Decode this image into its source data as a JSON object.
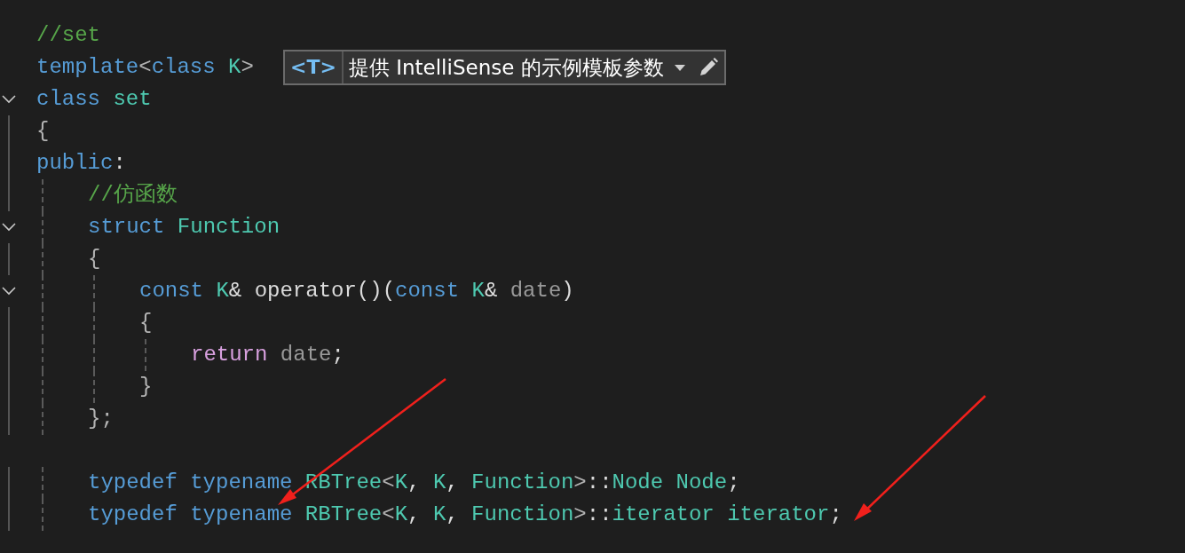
{
  "editor": {
    "lines": [
      {
        "tokens": [
          {
            "kind": "comment",
            "text": "//set"
          }
        ]
      },
      {
        "tokens": [
          {
            "kind": "keyword",
            "text": "template"
          },
          {
            "kind": "punct",
            "text": "<"
          },
          {
            "kind": "keyword",
            "text": "class "
          },
          {
            "kind": "type",
            "text": "K"
          },
          {
            "kind": "punct",
            "text": ">"
          }
        ]
      },
      {
        "expanded": true,
        "tokens": [
          {
            "kind": "keyword",
            "text": "class "
          },
          {
            "kind": "type",
            "text": "set"
          }
        ]
      },
      {
        "tokens": [
          {
            "kind": "punct",
            "text": "{"
          }
        ]
      },
      {
        "tokens": [
          {
            "kind": "keyword",
            "text": "public"
          },
          {
            "kind": "plain",
            "text": ":"
          }
        ],
        "children": [
          {
            "tokens": [
              {
                "kind": "comment",
                "text": "//仿函数"
              }
            ]
          },
          {
            "expanded": true,
            "tokens": [
              {
                "kind": "keyword",
                "text": "struct "
              },
              {
                "kind": "type",
                "text": "Function"
              }
            ]
          },
          {
            "tokens": [
              {
                "kind": "punct",
                "text": "{"
              }
            ],
            "children": [
              {
                "expanded": true,
                "tokens": [
                  {
                    "kind": "keyword",
                    "text": "const "
                  },
                  {
                    "kind": "type",
                    "text": "K"
                  },
                  {
                    "kind": "plain",
                    "text": "& operator()("
                  },
                  {
                    "kind": "keyword",
                    "text": "const "
                  },
                  {
                    "kind": "type",
                    "text": "K"
                  },
                  {
                    "kind": "plain",
                    "text": "& "
                  },
                  {
                    "kind": "param",
                    "text": "date"
                  },
                  {
                    "kind": "plain",
                    "text": ")"
                  }
                ]
              },
              {
                "tokens": [
                  {
                    "kind": "punct",
                    "text": "{"
                  }
                ],
                "children": [
                  {
                    "tokens": [
                      {
                        "kind": "control",
                        "text": "return "
                      },
                      {
                        "kind": "param",
                        "text": "date"
                      },
                      {
                        "kind": "plain",
                        "text": ";"
                      }
                    ]
                  }
                ]
              },
              {
                "tokens": [
                  {
                    "kind": "punct",
                    "text": "}"
                  }
                ]
              }
            ]
          },
          {
            "tokens": [
              {
                "kind": "punct",
                "text": "};"
              }
            ]
          },
          {
            "gap_before": true,
            "tokens": [
              {
                "kind": "keyword",
                "text": "typedef typename "
              },
              {
                "kind": "type",
                "text": "RBTree"
              },
              {
                "kind": "punct",
                "text": "<"
              },
              {
                "kind": "type",
                "text": "K"
              },
              {
                "kind": "plain",
                "text": ", "
              },
              {
                "kind": "type",
                "text": "K"
              },
              {
                "kind": "plain",
                "text": ", "
              },
              {
                "kind": "type",
                "text": "Function"
              },
              {
                "kind": "punct",
                "text": ">"
              },
              {
                "kind": "plain",
                "text": "::"
              },
              {
                "kind": "type",
                "text": "Node Node"
              },
              {
                "kind": "plain",
                "text": ";"
              }
            ]
          },
          {
            "tokens": [
              {
                "kind": "keyword",
                "text": "typedef typename "
              },
              {
                "kind": "type",
                "text": "RBTree"
              },
              {
                "kind": "punct",
                "text": "<"
              },
              {
                "kind": "type",
                "text": "K"
              },
              {
                "kind": "plain",
                "text": ", "
              },
              {
                "kind": "type",
                "text": "K"
              },
              {
                "kind": "plain",
                "text": ", "
              },
              {
                "kind": "type",
                "text": "Function"
              },
              {
                "kind": "punct",
                "text": ">"
              },
              {
                "kind": "plain",
                "text": "::"
              },
              {
                "kind": "type",
                "text": "iterator iterator"
              },
              {
                "kind": "plain",
                "text": ";"
              }
            ]
          }
        ]
      }
    ]
  },
  "template_bar": {
    "icon_text": "<T>",
    "label": "提供 IntelliSense 的示例模板参数"
  }
}
